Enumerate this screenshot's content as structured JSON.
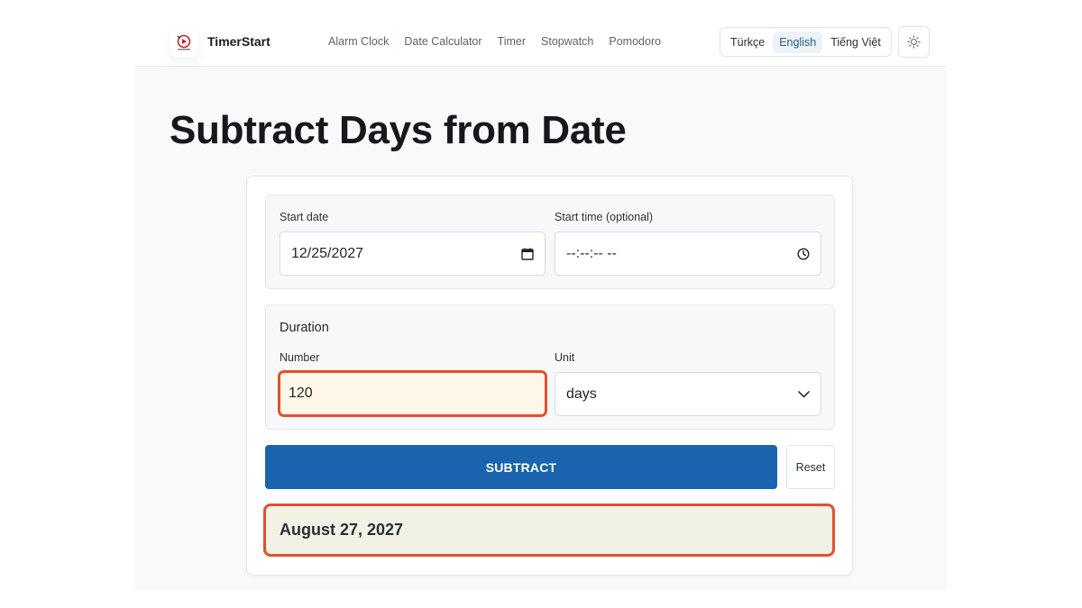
{
  "header": {
    "brand": "TimerStart",
    "nav": [
      "Alarm Clock",
      "Date Calculator",
      "Timer",
      "Stopwatch",
      "Pomodoro"
    ],
    "languages": [
      "Türkçe",
      "English",
      "Tiếng Việt"
    ],
    "active_language": "English",
    "theme_icon": "sun-icon"
  },
  "main": {
    "title": "Subtract Days from Date",
    "start_date": {
      "label": "Start date",
      "value": "12/25/2027",
      "icon": "calendar-icon"
    },
    "start_time": {
      "label": "Start time (optional)",
      "value": "--:--:-- --",
      "icon": "clock-icon"
    },
    "duration": {
      "heading": "Duration",
      "number_label": "Number",
      "number_value": "120",
      "unit_label": "Unit",
      "unit_value": "days"
    },
    "subtract_label": "SUBTRACT",
    "reset_label": "Reset",
    "result": "August 27, 2027"
  },
  "colors": {
    "primary_button": "#1a64ad",
    "highlight_border": "#e0522b",
    "result_bg": "#f1f1e6",
    "number_field_bg": "#fff8e8"
  }
}
